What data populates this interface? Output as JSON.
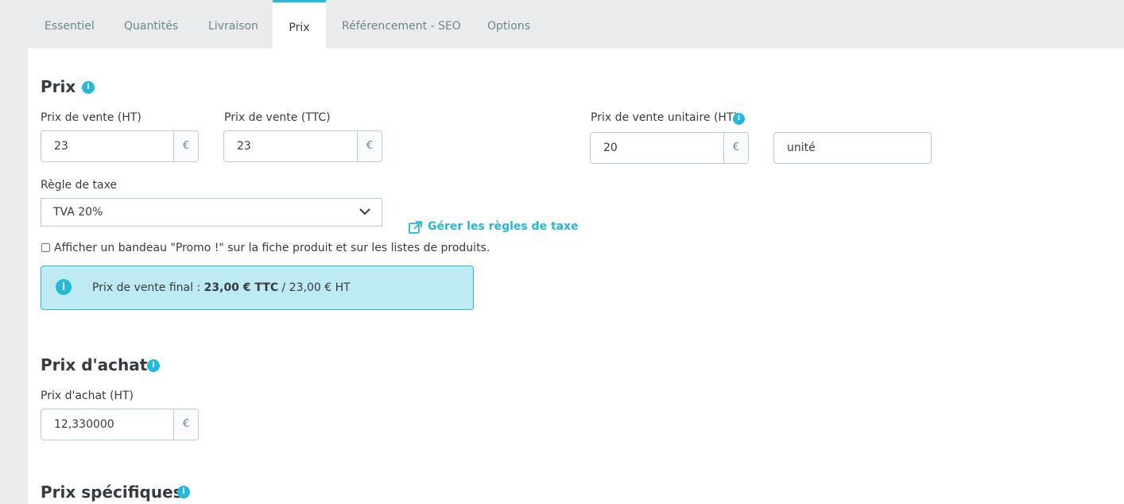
{
  "tabs": [
    {
      "label": "Essentiel"
    },
    {
      "label": "Quantités"
    },
    {
      "label": "Livraison"
    },
    {
      "label": "Prix"
    },
    {
      "label": "Référencement - SEO"
    },
    {
      "label": "Options"
    }
  ],
  "active_tab": "Prix",
  "prix": {
    "title": "Prix",
    "info_glyph": "i",
    "sale_ht": {
      "label": "Prix de vente (HT)",
      "value": "23",
      "currency": "€"
    },
    "sale_ttc": {
      "label": "Prix de vente (TTC)",
      "value": "23",
      "currency": "€"
    },
    "unit_price": {
      "label": "Prix de vente unitaire (HT)",
      "value": "20",
      "currency": "€",
      "unit": "unité"
    },
    "tax_rule": {
      "label": "Règle de taxe",
      "selected": "TVA 20%"
    },
    "manage_tax_link": "Gérer les règles de taxe",
    "promo_checkbox": {
      "label": "Afficher un bandeau \"Promo !\" sur la fiche produit et sur les listes de produits.",
      "checked": false
    },
    "final_price": {
      "prefix": "Prix de vente final : ",
      "ttc": "23,00 € TTC",
      "suffix": " / 23,00 € HT"
    }
  },
  "achat": {
    "title": "Prix d'achat",
    "label": "Prix d'achat (HT)",
    "value": "12,330000",
    "currency": "€"
  },
  "specifiques": {
    "title": "Prix spécifiques"
  },
  "colors": {
    "accent": "#25b9d7",
    "alert_bg": "#beeaf3",
    "page_bg": "#eaebec",
    "text": "#363a41"
  }
}
